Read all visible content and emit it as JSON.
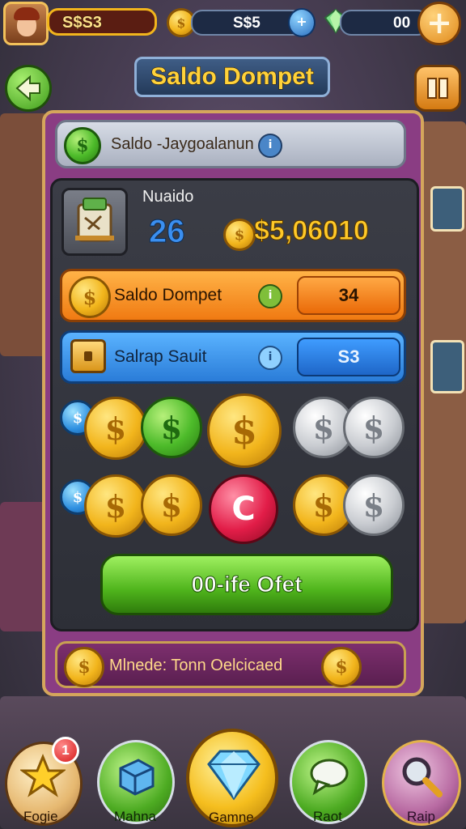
{
  "hud": {
    "player_currency": "S$S3",
    "coin_currency": "S$5",
    "gem_currency": "00"
  },
  "title": "Saldo Dompet",
  "search_bar": {
    "label": "Saldo -Jaygoalanun"
  },
  "balance_card": {
    "name": "Nuaido",
    "level": "26",
    "amount": "$5,06010"
  },
  "rows": [
    {
      "label": "Saldo Dompet",
      "value": "34"
    },
    {
      "label": "Salrap Sauit",
      "value": "S3"
    }
  ],
  "coin_glyph": "$",
  "action_button": "00-ife Ofet",
  "footer_banner": "Mlnede: Tonn Oelcicaed",
  "bottom_nav": [
    {
      "label": "Fogie",
      "badge": "1",
      "icon": "star-icon"
    },
    {
      "label": "Mahna",
      "icon": "cube-icon"
    },
    {
      "label": "Gamne",
      "icon": "diamond-icon"
    },
    {
      "label": "Raot",
      "icon": "chat-icon"
    },
    {
      "label": "Raip",
      "icon": "magnifier-icon"
    }
  ],
  "colors": {
    "accent_gold": "#f2b51c",
    "orange_row": "#f7931e",
    "blue_row": "#2f8fe8",
    "green_button": "#5fc52a",
    "panel_border": "#a4489a"
  }
}
